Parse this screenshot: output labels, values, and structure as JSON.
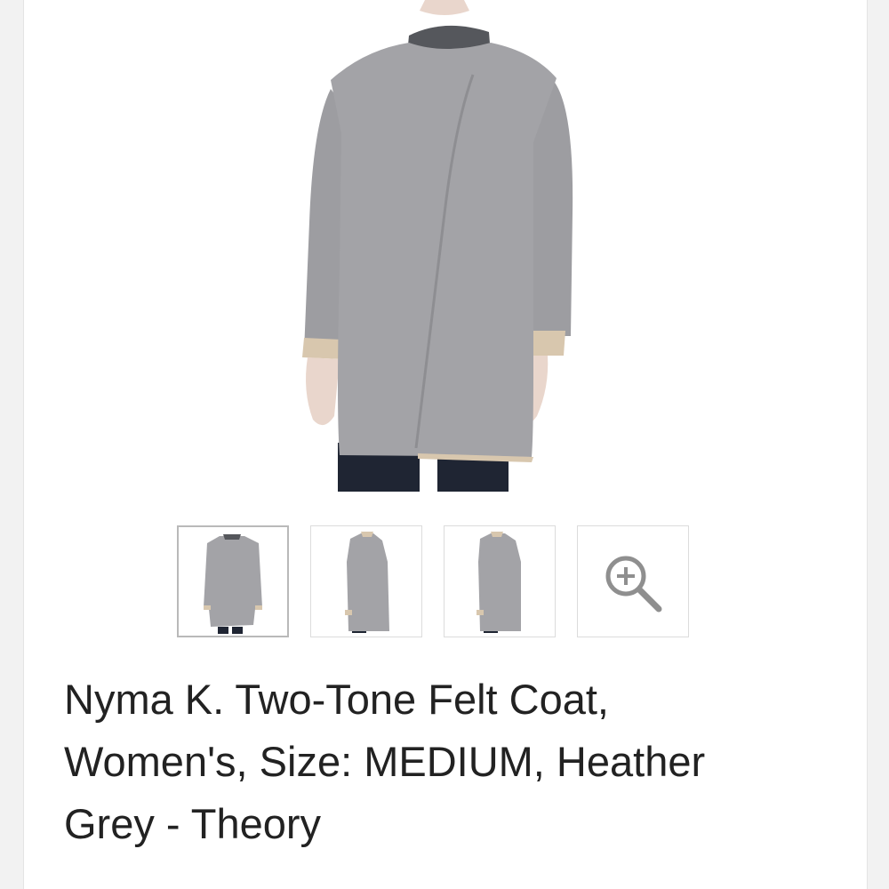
{
  "product": {
    "title": "Nyma K. Two-Tone Felt Coat, Women's, Size: MEDIUM, Heather Grey - Theory"
  },
  "gallery": {
    "thumbnails": [
      {
        "view": "front",
        "selected": true
      },
      {
        "view": "side",
        "selected": false
      },
      {
        "view": "side-alt",
        "selected": false
      },
      {
        "view": "zoom",
        "icon": "zoom-in-icon",
        "selected": false
      }
    ]
  },
  "colors": {
    "coat": "#a3a3a7",
    "coat_shadow": "#8e8e92",
    "cuff": "#d8c7ae",
    "pants": "#1f2533",
    "skin": "#e9d6cc",
    "collar": "#55575c"
  }
}
